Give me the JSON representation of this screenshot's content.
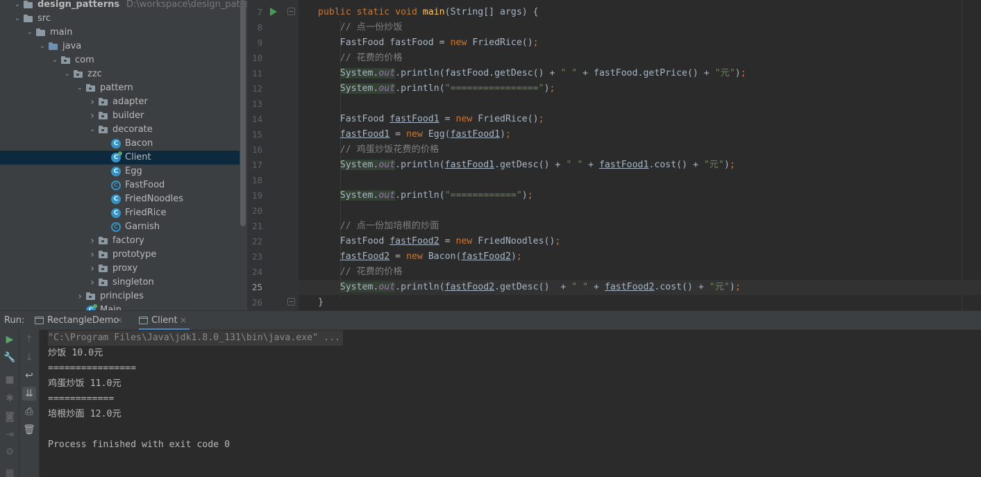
{
  "project_tree": {
    "items": [
      {
        "label": "design_patterns",
        "hint": "D:\\workspace\\design_patterns",
        "kind": "module",
        "expanded": true
      },
      {
        "label": "src",
        "kind": "folder",
        "expanded": true
      },
      {
        "label": "main",
        "kind": "folder",
        "expanded": true
      },
      {
        "label": "java",
        "kind": "source-folder",
        "expanded": true
      },
      {
        "label": "com",
        "kind": "package",
        "expanded": true
      },
      {
        "label": "zzc",
        "kind": "package",
        "expanded": true
      },
      {
        "label": "pattern",
        "kind": "package",
        "expanded": true
      },
      {
        "label": "adapter",
        "kind": "package",
        "expanded": false
      },
      {
        "label": "builder",
        "kind": "package",
        "expanded": false
      },
      {
        "label": "decorate",
        "kind": "package",
        "expanded": true
      },
      {
        "label": "Bacon",
        "kind": "class"
      },
      {
        "label": "Client",
        "kind": "main-class",
        "selected": true
      },
      {
        "label": "Egg",
        "kind": "class"
      },
      {
        "label": "FastFood",
        "kind": "abstract-class"
      },
      {
        "label": "FriedNoodles",
        "kind": "class"
      },
      {
        "label": "FriedRice",
        "kind": "class"
      },
      {
        "label": "Garnish",
        "kind": "abstract-class"
      },
      {
        "label": "factory",
        "kind": "package",
        "expanded": false
      },
      {
        "label": "prototype",
        "kind": "package",
        "expanded": false
      },
      {
        "label": "proxy",
        "kind": "package",
        "expanded": false
      },
      {
        "label": "singleton",
        "kind": "package",
        "expanded": false
      },
      {
        "label": "principles",
        "kind": "package",
        "expanded": false
      },
      {
        "label": "Main",
        "kind": "main-class"
      }
    ]
  },
  "editor": {
    "current_line": "25",
    "lines": [
      {
        "n": "7",
        "tokens": [
          [
            "kw",
            "public static void "
          ],
          [
            "fn",
            "main"
          ],
          [
            "",
            "(String[] args) {"
          ]
        ]
      },
      {
        "n": "8",
        "tokens": [
          [
            "",
            "    "
          ],
          [
            "cmt",
            "// 点一份炒饭"
          ]
        ]
      },
      {
        "n": "9",
        "tokens": [
          [
            "",
            "    FastFood fastFood = "
          ],
          [
            "kw",
            "new "
          ],
          [
            "",
            "FriedRice()"
          ],
          [
            "kw",
            ";"
          ]
        ]
      },
      {
        "n": "10",
        "tokens": [
          [
            "",
            "    "
          ],
          [
            "cmt",
            "// 花费的价格"
          ]
        ]
      },
      {
        "n": "11",
        "tokens": [
          [
            "",
            "    "
          ],
          [
            "sys",
            "System."
          ],
          [
            "fldsys",
            "out"
          ],
          [
            "",
            ".println(fastFood.getDesc() + "
          ],
          [
            "str",
            "\" \""
          ],
          [
            "",
            " + fastFood.getPrice() + "
          ],
          [
            "str",
            "\"元\""
          ],
          [
            "",
            ")"
          ],
          [
            "kw",
            ";"
          ]
        ]
      },
      {
        "n": "12",
        "tokens": [
          [
            "",
            "    "
          ],
          [
            "sys",
            "System."
          ],
          [
            "fldsys",
            "out"
          ],
          [
            "",
            ".println("
          ],
          [
            "str",
            "\"================\""
          ],
          [
            "",
            ")"
          ],
          [
            "kw",
            ";"
          ]
        ]
      },
      {
        "n": "13",
        "tokens": []
      },
      {
        "n": "14",
        "tokens": [
          [
            "",
            "    FastFood "
          ],
          [
            "ul",
            "fastFood1"
          ],
          [
            "",
            " = "
          ],
          [
            "kw",
            "new "
          ],
          [
            "",
            "FriedRice()"
          ],
          [
            "kw",
            ";"
          ]
        ]
      },
      {
        "n": "15",
        "tokens": [
          [
            "",
            "    "
          ],
          [
            "ul",
            "fastFood1"
          ],
          [
            "",
            " = "
          ],
          [
            "kw",
            "new "
          ],
          [
            "",
            "Egg("
          ],
          [
            "ul",
            "fastFood1"
          ],
          [
            "",
            ")"
          ],
          [
            "kw",
            ";"
          ]
        ]
      },
      {
        "n": "16",
        "tokens": [
          [
            "",
            "    "
          ],
          [
            "cmt",
            "// 鸡蛋炒饭花费的价格"
          ]
        ]
      },
      {
        "n": "17",
        "tokens": [
          [
            "",
            "    "
          ],
          [
            "sys",
            "System."
          ],
          [
            "fldsys",
            "out"
          ],
          [
            "",
            ".println("
          ],
          [
            "ul",
            "fastFood1"
          ],
          [
            "",
            ".getDesc() + "
          ],
          [
            "str",
            "\" \""
          ],
          [
            "",
            " + "
          ],
          [
            "ul",
            "fastFood1"
          ],
          [
            "",
            ".cost() + "
          ],
          [
            "str",
            "\"元\""
          ],
          [
            "",
            ")"
          ],
          [
            "kw",
            ";"
          ]
        ]
      },
      {
        "n": "18",
        "tokens": []
      },
      {
        "n": "19",
        "tokens": [
          [
            "",
            "    "
          ],
          [
            "sys",
            "System."
          ],
          [
            "fldsys",
            "out"
          ],
          [
            "",
            ".println("
          ],
          [
            "str",
            "\"============\""
          ],
          [
            "",
            ")"
          ],
          [
            "kw",
            ";"
          ]
        ]
      },
      {
        "n": "20",
        "tokens": []
      },
      {
        "n": "21",
        "tokens": [
          [
            "",
            "    "
          ],
          [
            "cmt",
            "// 点一份加培根的炒面"
          ]
        ]
      },
      {
        "n": "22",
        "tokens": [
          [
            "",
            "    FastFood "
          ],
          [
            "ul",
            "fastFood2"
          ],
          [
            "",
            " = "
          ],
          [
            "kw",
            "new "
          ],
          [
            "",
            "FriedNoodles()"
          ],
          [
            "kw",
            ";"
          ]
        ]
      },
      {
        "n": "23",
        "tokens": [
          [
            "",
            "    "
          ],
          [
            "ul",
            "fastFood2"
          ],
          [
            "",
            " = "
          ],
          [
            "kw",
            "new "
          ],
          [
            "",
            "Bacon("
          ],
          [
            "ul",
            "fastFood2"
          ],
          [
            "",
            ")"
          ],
          [
            "kw",
            ";"
          ]
        ]
      },
      {
        "n": "24",
        "tokens": [
          [
            "",
            "    "
          ],
          [
            "cmt",
            "// 花费的价格"
          ]
        ]
      },
      {
        "n": "25",
        "tokens": [
          [
            "",
            "    "
          ],
          [
            "sys",
            "System."
          ],
          [
            "fldsys",
            "out"
          ],
          [
            "",
            ".println("
          ],
          [
            "ul",
            "fastFood2"
          ],
          [
            "",
            ".getDesc()  + "
          ],
          [
            "str",
            "\" \""
          ],
          [
            "",
            " + "
          ],
          [
            "ul",
            "fastFood2"
          ],
          [
            "",
            ".cost() + "
          ],
          [
            "str",
            "\"元\""
          ],
          [
            "",
            ")"
          ],
          [
            "kw",
            ";"
          ]
        ]
      },
      {
        "n": "26",
        "tokens": [
          [
            "",
            "}"
          ]
        ]
      }
    ]
  },
  "run_panel": {
    "label": "Run:",
    "tabs": [
      {
        "label": "RectangleDemo",
        "active": false
      },
      {
        "label": "Client",
        "active": true
      }
    ],
    "output": [
      {
        "text": "\"C:\\Program Files\\Java\\jdk1.8.0_131\\bin\\java.exe\" ...",
        "kind": "cmd"
      },
      {
        "text": "炒饭 10.0元",
        "kind": "out"
      },
      {
        "text": "================",
        "kind": "out"
      },
      {
        "text": "鸡蛋炒饭 11.0元",
        "kind": "out"
      },
      {
        "text": "============",
        "kind": "out"
      },
      {
        "text": "培根炒面 12.0元",
        "kind": "out"
      },
      {
        "text": "",
        "kind": "out"
      },
      {
        "text": "Process finished with exit code 0",
        "kind": "out"
      }
    ]
  },
  "colors": {
    "keyword": "#cc7832",
    "method": "#ffc66d",
    "string": "#6a8759",
    "comment": "#808080",
    "field": "#9876aa",
    "selection": "#0d293e",
    "run_green": "#59a869"
  }
}
